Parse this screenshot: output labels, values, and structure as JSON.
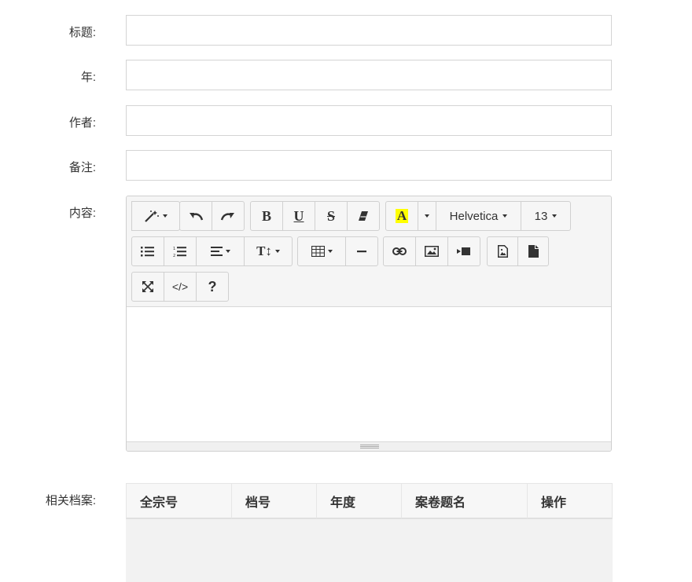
{
  "form": {
    "title_label": "标题:",
    "title_value": "",
    "year_label": "年:",
    "year_value": "",
    "author_label": "作者:",
    "author_value": "",
    "note_label": "备注:",
    "note_value": "",
    "content_label": "内容:",
    "related_label": "相关档案:"
  },
  "editor": {
    "font_name": "Helvetica",
    "font_size": "13",
    "bold": "B",
    "underline": "U",
    "strike": "S",
    "color": "A",
    "text_size_icon": "T↕",
    "help": "?",
    "code": "</>",
    "highlight_color": "#ffff00"
  },
  "table": {
    "columns": [
      "全宗号",
      "档号",
      "年度",
      "案卷题名",
      "操作"
    ],
    "rows": []
  }
}
